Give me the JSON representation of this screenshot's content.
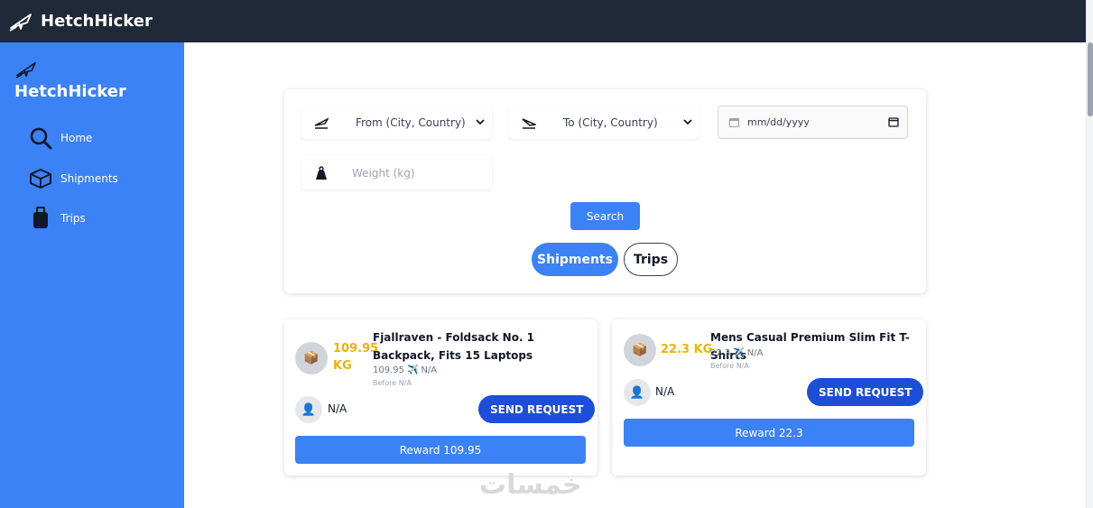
{
  "app": {
    "title": "HetchHicker"
  },
  "sidebar": {
    "title": "HetchHicker",
    "items": [
      {
        "label": "Home",
        "icon": "search-icon"
      },
      {
        "label": "Shipments",
        "icon": "package-icon"
      },
      {
        "label": "Trips",
        "icon": "suitcase-icon"
      }
    ]
  },
  "search": {
    "from_placeholder": "From (City, Country)",
    "to_placeholder": "To (City, Country)",
    "date_placeholder": "mm/dd/yyyy",
    "weight_placeholder": "Weight (kg)",
    "search_label": "Search",
    "tabs": [
      {
        "label": "Shipments",
        "active": true
      },
      {
        "label": "Trips",
        "active": false
      }
    ]
  },
  "shipments": [
    {
      "weight": "109.95 KG",
      "title": "Fjallraven - Foldsack No. 1 Backpack, Fits 15 Laptops",
      "meta_value": "109.95",
      "meta_dest": "N/A",
      "before": "Before N/A",
      "user": "N/A",
      "send_label": "SEND REQUEST",
      "reward": "Reward 109.95"
    },
    {
      "weight": "22.3 KG",
      "title": "Mens Casual Premium Slim Fit T-Shirts",
      "meta_value": "22.3",
      "meta_dest": "N/A",
      "before": "Before N/A",
      "user": "N/A",
      "send_label": "SEND REQUEST",
      "reward": "Reward 22.3"
    }
  ],
  "watermark": "خمسات",
  "colors": {
    "accent": "#3b82f6",
    "topbar": "#1f2937",
    "weight": "#eab308",
    "send": "#1d4ed8"
  }
}
